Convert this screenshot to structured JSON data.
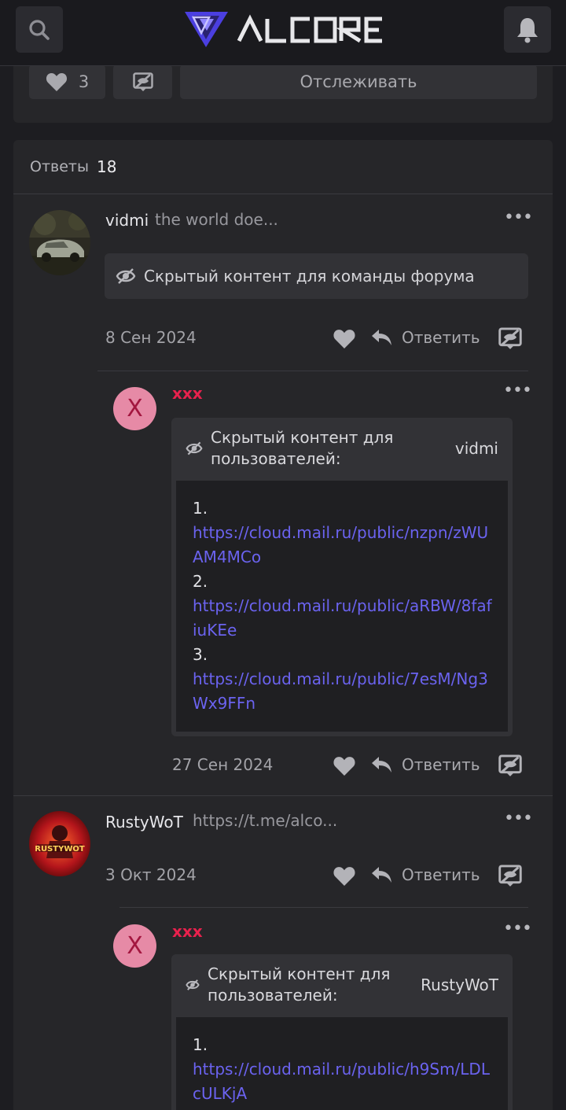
{
  "header": {
    "logo_text": "ALCORE",
    "search_icon": "search-icon",
    "bell_icon": "bell-icon"
  },
  "topbar": {
    "like_count": "3",
    "follow_label": "Отслеживать"
  },
  "replies": {
    "label": "Ответы",
    "count": "18",
    "posts": [
      {
        "author": "vidmi",
        "title": "the world doe...",
        "hidden_text": "Скрытый контент для команды форума",
        "date": "8 Сен 2024",
        "reply_label": "Ответить",
        "sub": {
          "avatar_letter": "X",
          "author": "xxx",
          "hidden_title": "Скрытый контент для пользователей:",
          "hidden_for": "vidmi",
          "links": [
            {
              "num": "1.",
              "url": "https://cloud.mail.ru/public/nzpn/zWUAM4MCo"
            },
            {
              "num": "2.",
              "url": "https://cloud.mail.ru/public/aRBW/8fafiuKEe"
            },
            {
              "num": "3.",
              "url": "https://cloud.mail.ru/public/7esM/Ng3Wx9FFn"
            }
          ],
          "date": "27 Сен 2024",
          "reply_label": "Ответить"
        }
      },
      {
        "author": "RustyWoT",
        "title": "https://t.me/alco...",
        "avatar_text": "RUSTYWOT",
        "date": "3 Окт 2024",
        "reply_label": "Ответить",
        "sub": {
          "avatar_letter": "X",
          "author": "xxx",
          "hidden_title": "Скрытый контент для пользователей:",
          "hidden_for": "RustyWoT",
          "links": [
            {
              "num": "1.",
              "url": "https://cloud.mail.ru/public/h9Sm/LDLcULKjA"
            }
          ]
        }
      }
    ]
  },
  "colors": {
    "accent_link": "#6b63f0",
    "username_red": "#e8214d",
    "avatar_pink": "#e68aa6"
  }
}
